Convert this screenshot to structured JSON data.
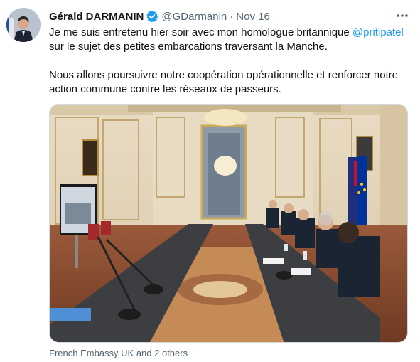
{
  "tweet": {
    "author_name": "Gérald DARMANIN",
    "handle": "@GDarmanin",
    "separator": "·",
    "date": "Nov 16",
    "text_line1_before": "Je me suis entretenu hier soir avec mon homologue britannique ",
    "mention": "@pritipatel",
    "text_line1_after": " sur le sujet des petites embarcations traversant la Manche.",
    "paragraph2": "Nous allons poursuivre notre coopération opérationnelle et renforcer notre action commune contre les réseaux de passeurs.",
    "tagged": "French Embassy UK and 2 others"
  },
  "icons": {
    "verified": "verified-badge-icon",
    "more": "more-options-icon"
  },
  "colors": {
    "link": "#1d9bf0",
    "secondary_text": "#536471",
    "verified": "#1d9bf0"
  }
}
